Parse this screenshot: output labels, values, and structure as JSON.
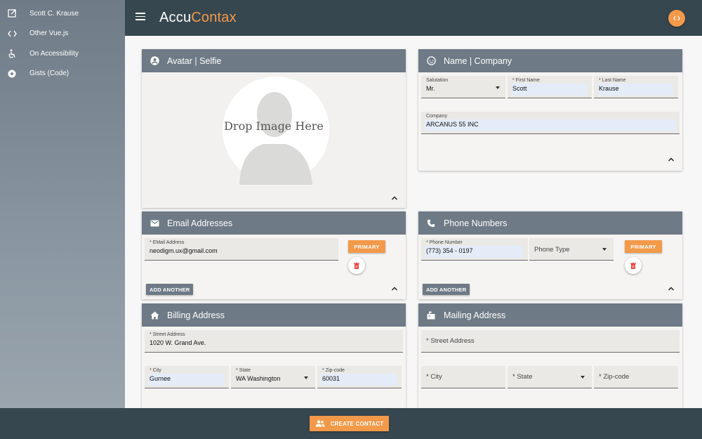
{
  "sidebar": {
    "items": [
      {
        "label": "Scott C. Krause",
        "icon": "open-in-new-icon"
      },
      {
        "label": "Other Vue.js",
        "icon": "code-icon"
      },
      {
        "label": "On Accessibility",
        "icon": "accessibility-icon"
      },
      {
        "label": "Gists (Code)",
        "icon": "disc-icon"
      }
    ]
  },
  "header": {
    "brand_part1": "Accu",
    "brand_part2": "Contax",
    "accent_color": "#f2994a"
  },
  "avatar_card": {
    "title": "Avatar | Selfie",
    "drop_text": "Drop Image Here"
  },
  "name_card": {
    "title": "Name | Company",
    "salutation_label": "Salutation",
    "salutation_value": "Mr.",
    "first_name_label": "* First Name",
    "first_name_value": "Scott",
    "last_name_label": "* Last Name",
    "last_name_value": "Krause",
    "company_label": "Company",
    "company_value": "ARCANUS 55 INC"
  },
  "email_card": {
    "title": "Email Addresses",
    "email_label": "* EMail Address",
    "email_value": "neodigm.ux@gmail.com",
    "primary_label": "PRIMARY",
    "add_label": "ADD ANOTHER"
  },
  "phone_card": {
    "title": "Phone Numbers",
    "phone_label": "* Phone Number",
    "phone_value": "(773) 354 - 0197",
    "phone_type_placeholder": "Phone Type",
    "primary_label": "PRIMARY",
    "add_label": "ADD ANOTHER"
  },
  "billing_card": {
    "title": "Billing Address",
    "street_label": "* Street Address",
    "street_value": "1020 W. Grand Ave.",
    "city_label": "* City",
    "city_value": "Gurnee",
    "state_label": "* State",
    "state_value": "WA Washington",
    "zip_label": "* Zip-code",
    "zip_value": "60031"
  },
  "mailing_card": {
    "title": "Mailing Address",
    "street_placeholder": "* Street Address",
    "city_placeholder": "* City",
    "state_placeholder": "* State",
    "zip_placeholder": "* Zip-code"
  },
  "footer": {
    "create_label": "CREATE CONTACT"
  }
}
